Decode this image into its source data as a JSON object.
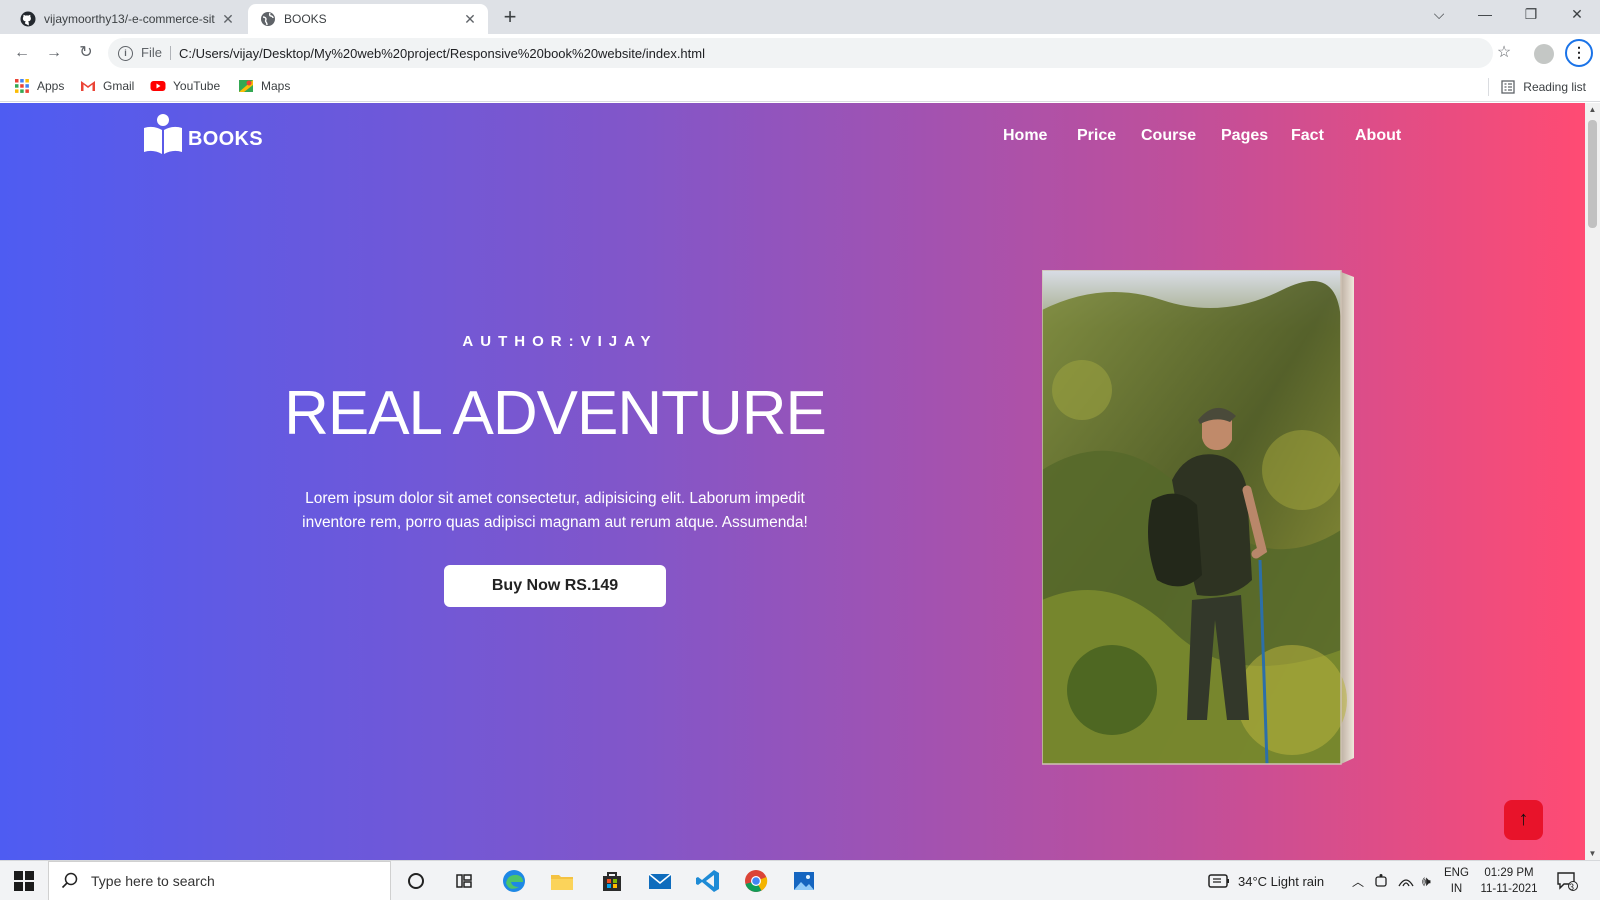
{
  "browser": {
    "tabs": [
      {
        "title": "vijaymoorthy13/-e-commerce-sit",
        "favicon": "github-icon",
        "active": false
      },
      {
        "title": "BOOKS",
        "favicon": "globe-icon",
        "active": true
      }
    ],
    "address": {
      "scheme_label": "File",
      "url": "C:/Users/vijay/Desktop/My%20web%20project/Responsive%20book%20website/index.html"
    },
    "bookmarks": [
      {
        "label": "Apps",
        "icon": "apps-grid-icon"
      },
      {
        "label": "Gmail",
        "icon": "gmail-icon"
      },
      {
        "label": "YouTube",
        "icon": "youtube-icon"
      },
      {
        "label": "Maps",
        "icon": "maps-icon"
      }
    ],
    "reading_list_label": "Reading list"
  },
  "page": {
    "logo_text": "BOOKS",
    "nav": [
      "Home",
      "Price",
      "Course",
      "Pages",
      "Fact",
      "About"
    ],
    "author": "AUTHOR:VIJAY",
    "headline": "REAL ADVENTURE",
    "blurb": "Lorem ipsum dolor sit amet consectetur, adipisicing elit. Laborum impedit inventore rem, porro quas adipisci magnam aut rerum atque. Assumenda!",
    "buy_button": "Buy Now RS.149",
    "colors": {
      "gradient_start": "#4e5cf2",
      "gradient_end": "#ff4b73",
      "scroll_top_button": "#e8132a"
    }
  },
  "taskbar": {
    "search_placeholder": "Type here to search",
    "weather": "34°C  Light rain",
    "language": {
      "line1": "ENG",
      "line2": "IN"
    },
    "time": "01:29 PM",
    "date": "11-11-2021",
    "notifications": "3"
  }
}
